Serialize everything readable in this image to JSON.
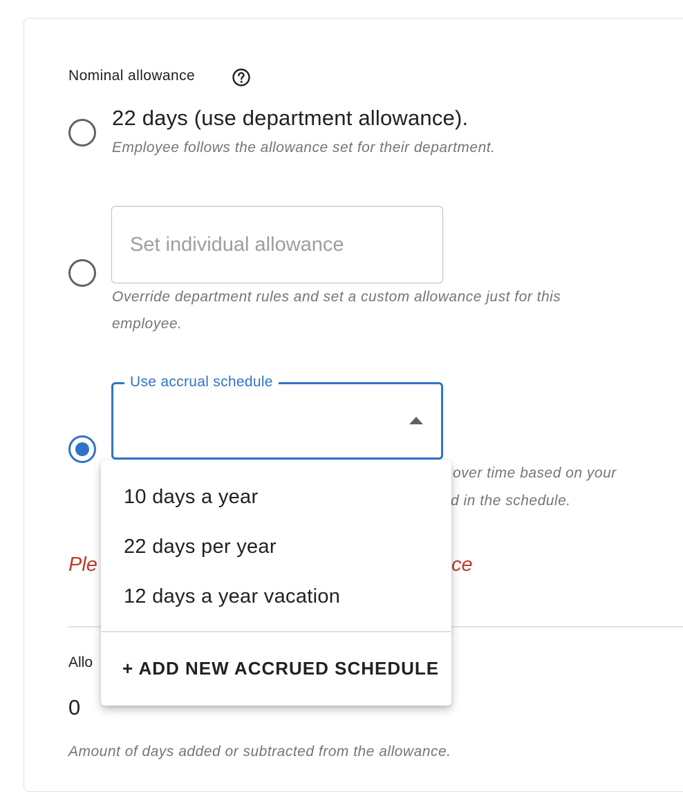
{
  "nominal_allowance": {
    "label": "Nominal allowance",
    "help_icon": "help-circle-icon",
    "options": [
      {
        "title": "22 days (use department allowance).",
        "helper": "Employee follows the allowance set for their department.",
        "selected": false
      },
      {
        "input_placeholder": "Set individual allowance",
        "input_value": "",
        "helper_line1": "Override department rules and set a custom allowance just for this",
        "helper_line2": "employee.",
        "selected": false
      },
      {
        "select_label": "Use accrual schedule",
        "select_value": "",
        "helper_line1_visible": "over time based on your",
        "helper_line2_visible": "d in the schedule.",
        "selected": true,
        "caret_icon": "caret-up-icon"
      }
    ],
    "error_visible_start": "Ple",
    "error_visible_end": "ce"
  },
  "dropdown": {
    "options": [
      "10 days a year",
      "22 days per year",
      "12 days a year vacation"
    ],
    "action_label": "+ ADD NEW ACCRUED SCHEDULE"
  },
  "adjustment": {
    "label_visible": "Allo",
    "value": "0",
    "helper": "Amount of days added or subtracted from the allowance."
  },
  "colors": {
    "accent": "#2f73c9",
    "error": "#c0392b",
    "helper_text": "#757575"
  }
}
